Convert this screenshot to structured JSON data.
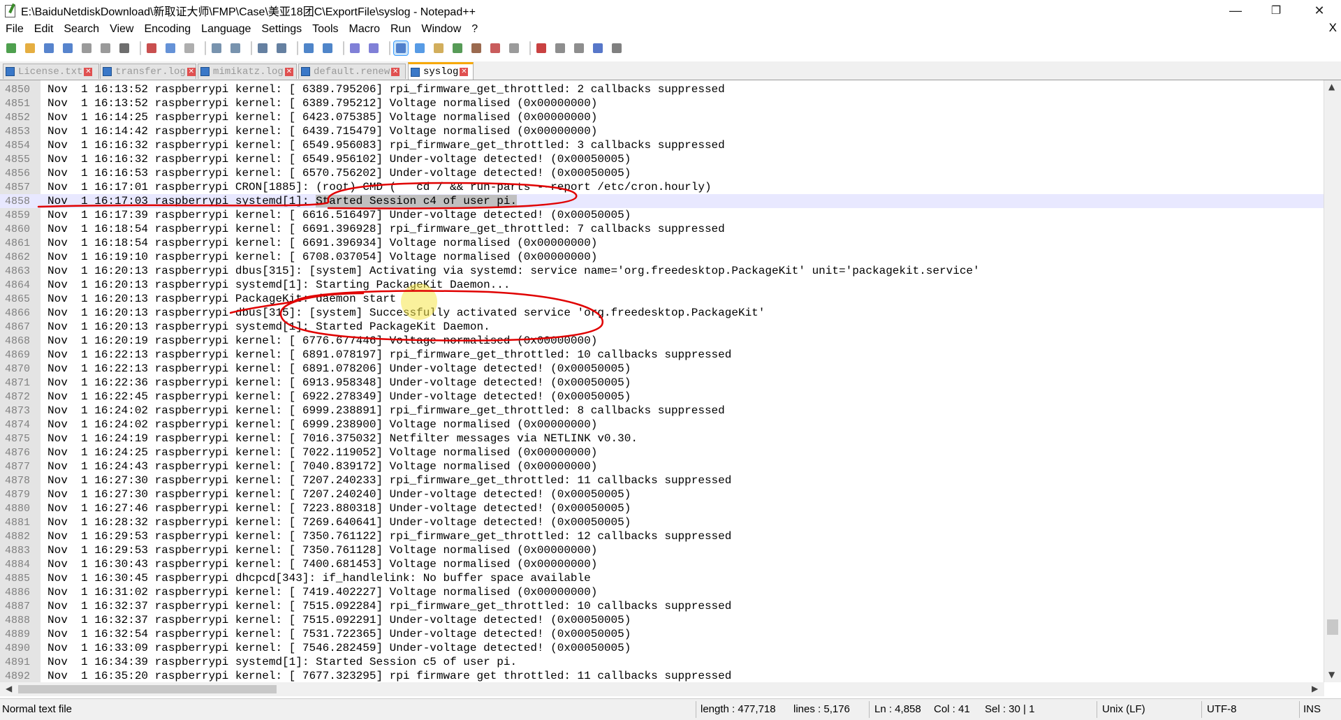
{
  "window": {
    "title": "E:\\BaiduNetdiskDownload\\新取证大师\\FMP\\Case\\美亚18团C\\ExportFile\\syslog - Notepad++",
    "minimize": "—",
    "restore": "❐",
    "close": "✕"
  },
  "menu": [
    "File",
    "Edit",
    "Search",
    "View",
    "Encoding",
    "Language",
    "Settings",
    "Tools",
    "Macro",
    "Run",
    "Window",
    "?"
  ],
  "menu_close": "X",
  "toolbar_icons": [
    "new-file-icon",
    "open-file-icon",
    "save-icon",
    "save-all-icon",
    "close-icon",
    "close-all-icon",
    "print-icon",
    "cut-icon",
    "copy-icon",
    "paste-icon",
    "undo-icon",
    "redo-icon",
    "find-icon",
    "replace-icon",
    "zoom-in-icon",
    "zoom-out-icon",
    "sync-vertical-icon",
    "sync-horizontal-icon",
    "word-wrap-icon",
    "show-all-chars-icon",
    "indent-guide-icon",
    "document-map-icon",
    "function-list-icon",
    "folder-workspace-icon",
    "monitoring-icon",
    "record-macro-icon",
    "stop-record-icon",
    "play-macro-icon",
    "run-macro-multiple-icon",
    "save-macro-icon"
  ],
  "tabs": [
    {
      "label": "License.txt",
      "active": false
    },
    {
      "label": "transfer.log",
      "active": false
    },
    {
      "label": "mimikatz.log",
      "active": false
    },
    {
      "label": "default.renew",
      "active": false
    },
    {
      "label": "syslog",
      "active": true
    }
  ],
  "editor": {
    "current_line": 4858,
    "lines": [
      {
        "n": "4850",
        "t": "Nov  1 16:13:52 raspberrypi kernel: [ 6389.795206] rpi_firmware_get_throttled: 2 callbacks suppressed"
      },
      {
        "n": "4851",
        "t": "Nov  1 16:13:52 raspberrypi kernel: [ 6389.795212] Voltage normalised (0x00000000)"
      },
      {
        "n": "4852",
        "t": "Nov  1 16:14:25 raspberrypi kernel: [ 6423.075385] Voltage normalised (0x00000000)"
      },
      {
        "n": "4853",
        "t": "Nov  1 16:14:42 raspberrypi kernel: [ 6439.715479] Voltage normalised (0x00000000)"
      },
      {
        "n": "4854",
        "t": "Nov  1 16:16:32 raspberrypi kernel: [ 6549.956083] rpi_firmware_get_throttled: 3 callbacks suppressed"
      },
      {
        "n": "4855",
        "t": "Nov  1 16:16:32 raspberrypi kernel: [ 6549.956102] Under-voltage detected! (0x00050005)"
      },
      {
        "n": "4856",
        "t": "Nov  1 16:16:53 raspberrypi kernel: [ 6570.756202] Under-voltage detected! (0x00050005)"
      },
      {
        "n": "4857",
        "t": "Nov  1 16:17:01 raspberrypi CRON[1885]: (root) CMD (   cd / && run-parts --report /etc/cron.hourly)"
      },
      {
        "n": "4858",
        "t": "Nov  1 16:17:03 raspberrypi systemd[1]: ",
        "sel": "Started Session c4 of user pi."
      },
      {
        "n": "4859",
        "t": "Nov  1 16:17:39 raspberrypi kernel: [ 6616.516497] Under-voltage detected! (0x00050005)"
      },
      {
        "n": "4860",
        "t": "Nov  1 16:18:54 raspberrypi kernel: [ 6691.396928] rpi_firmware_get_throttled: 7 callbacks suppressed"
      },
      {
        "n": "4861",
        "t": "Nov  1 16:18:54 raspberrypi kernel: [ 6691.396934] Voltage normalised (0x00000000)"
      },
      {
        "n": "4862",
        "t": "Nov  1 16:19:10 raspberrypi kernel: [ 6708.037054] Voltage normalised (0x00000000)"
      },
      {
        "n": "4863",
        "t": "Nov  1 16:20:13 raspberrypi dbus[315]: [system] Activating via systemd: service name='org.freedesktop.PackageKit' unit='packagekit.service'"
      },
      {
        "n": "4864",
        "t": "Nov  1 16:20:13 raspberrypi systemd[1]: Starting PackageKit Daemon..."
      },
      {
        "n": "4865",
        "t": "Nov  1 16:20:13 raspberrypi PackageKit: daemon start"
      },
      {
        "n": "4866",
        "t": "Nov  1 16:20:13 raspberrypi dbus[315]: [system] Successfully activated service 'org.freedesktop.PackageKit'"
      },
      {
        "n": "4867",
        "t": "Nov  1 16:20:13 raspberrypi systemd[1]: Started PackageKit Daemon."
      },
      {
        "n": "4868",
        "t": "Nov  1 16:20:19 raspberrypi kernel: [ 6776.677446] Voltage normalised (0x00000000)"
      },
      {
        "n": "4869",
        "t": "Nov  1 16:22:13 raspberrypi kernel: [ 6891.078197] rpi_firmware_get_throttled: 10 callbacks suppressed"
      },
      {
        "n": "4870",
        "t": "Nov  1 16:22:13 raspberrypi kernel: [ 6891.078206] Under-voltage detected! (0x00050005)"
      },
      {
        "n": "4871",
        "t": "Nov  1 16:22:36 raspberrypi kernel: [ 6913.958348] Under-voltage detected! (0x00050005)"
      },
      {
        "n": "4872",
        "t": "Nov  1 16:22:45 raspberrypi kernel: [ 6922.278349] Under-voltage detected! (0x00050005)"
      },
      {
        "n": "4873",
        "t": "Nov  1 16:24:02 raspberrypi kernel: [ 6999.238891] rpi_firmware_get_throttled: 8 callbacks suppressed"
      },
      {
        "n": "4874",
        "t": "Nov  1 16:24:02 raspberrypi kernel: [ 6999.238900] Voltage normalised (0x00000000)"
      },
      {
        "n": "4875",
        "t": "Nov  1 16:24:19 raspberrypi kernel: [ 7016.375032] Netfilter messages via NETLINK v0.30."
      },
      {
        "n": "4876",
        "t": "Nov  1 16:24:25 raspberrypi kernel: [ 7022.119052] Voltage normalised (0x00000000)"
      },
      {
        "n": "4877",
        "t": "Nov  1 16:24:43 raspberrypi kernel: [ 7040.839172] Voltage normalised (0x00000000)"
      },
      {
        "n": "4878",
        "t": "Nov  1 16:27:30 raspberrypi kernel: [ 7207.240233] rpi_firmware_get_throttled: 11 callbacks suppressed"
      },
      {
        "n": "4879",
        "t": "Nov  1 16:27:30 raspberrypi kernel: [ 7207.240240] Under-voltage detected! (0x00050005)"
      },
      {
        "n": "4880",
        "t": "Nov  1 16:27:46 raspberrypi kernel: [ 7223.880318] Under-voltage detected! (0x00050005)"
      },
      {
        "n": "4881",
        "t": "Nov  1 16:28:32 raspberrypi kernel: [ 7269.640641] Under-voltage detected! (0x00050005)"
      },
      {
        "n": "4882",
        "t": "Nov  1 16:29:53 raspberrypi kernel: [ 7350.761122] rpi_firmware_get_throttled: 12 callbacks suppressed"
      },
      {
        "n": "4883",
        "t": "Nov  1 16:29:53 raspberrypi kernel: [ 7350.761128] Voltage normalised (0x00000000)"
      },
      {
        "n": "4884",
        "t": "Nov  1 16:30:43 raspberrypi kernel: [ 7400.681453] Voltage normalised (0x00000000)"
      },
      {
        "n": "4885",
        "t": "Nov  1 16:30:45 raspberrypi dhcpcd[343]: if_handlelink: No buffer space available"
      },
      {
        "n": "4886",
        "t": "Nov  1 16:31:02 raspberrypi kernel: [ 7419.402227] Voltage normalised (0x00000000)"
      },
      {
        "n": "4887",
        "t": "Nov  1 16:32:37 raspberrypi kernel: [ 7515.092284] rpi_firmware_get_throttled: 10 callbacks suppressed"
      },
      {
        "n": "4888",
        "t": "Nov  1 16:32:37 raspberrypi kernel: [ 7515.092291] Under-voltage detected! (0x00050005)"
      },
      {
        "n": "4889",
        "t": "Nov  1 16:32:54 raspberrypi kernel: [ 7531.722365] Under-voltage detected! (0x00050005)"
      },
      {
        "n": "4890",
        "t": "Nov  1 16:33:09 raspberrypi kernel: [ 7546.282459] Under-voltage detected! (0x00050005)"
      },
      {
        "n": "4891",
        "t": "Nov  1 16:34:39 raspberrypi systemd[1]: Started Session c5 of user pi."
      },
      {
        "n": "4892",
        "t": "Nov  1 16:35:20 raspberrypi kernel: [ 7677.323295] rpi firmware get throttled: 11 callbacks suppressed"
      }
    ]
  },
  "status": {
    "file_type": "Normal text file",
    "length": "length : 477,718",
    "lines": "lines : 5,176",
    "ln": "Ln : 4,858",
    "col": "Col : 41",
    "sel": "Sel : 30 | 1",
    "eol": "Unix (LF)",
    "encoding": "UTF-8",
    "mode": "INS"
  },
  "colors": {
    "annotation": "#e00000",
    "highlight_spot": "#f5e64a",
    "current_line_bg": "#e8e8ff",
    "active_tab_accent": "#f7a800"
  }
}
